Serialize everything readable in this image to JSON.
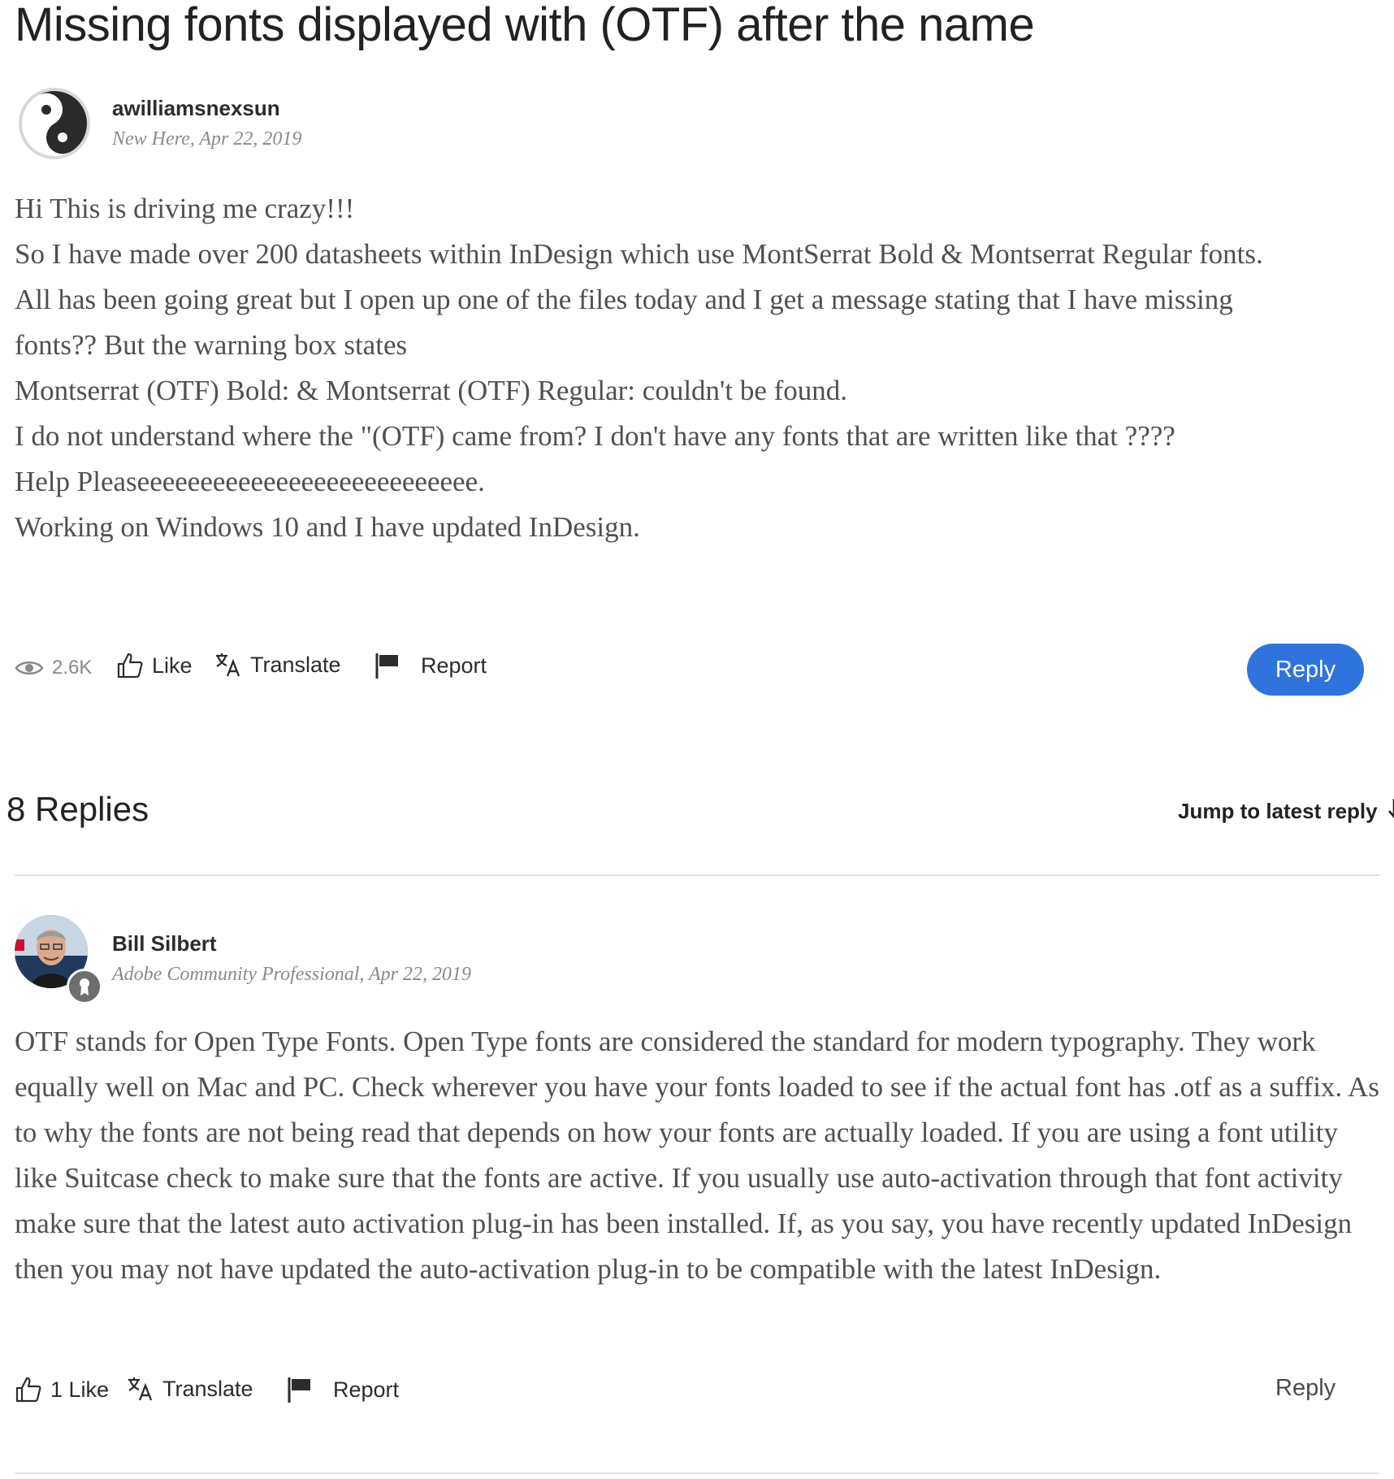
{
  "title": "Missing fonts displayed with (OTF) after the name",
  "post": {
    "author": "awilliamsnexsun",
    "rank": "New Here",
    "date": "Apr 22, 2019",
    "lines": [
      "Hi This is driving me crazy!!!",
      "So I have made over 200 datasheets within InDesign which use MontSerrat Bold & Montserrat Regular fonts.",
      "All has been going great but I open up one of the files today and I get a message stating that I have missing",
      "fonts?? But the warning box states",
      "Montserrat (OTF) Bold: & Montserrat (OTF) Regular: couldn't be found.",
      "I do not understand where the \"(OTF) came from? I don't have any fonts that are written like that ????",
      "Help Pleaseeeeeeeeeeeeeeeeeeeeeeeeeee.",
      "Working on Windows 10 and I have updated InDesign."
    ],
    "views": "2.6K",
    "like_label": "Like",
    "translate_label": "Translate",
    "report_label": "Report",
    "reply_label": "Reply"
  },
  "replies_heading": "8 Replies",
  "jump_label": "Jump to latest reply",
  "reply": {
    "author": "Bill Silbert",
    "rank": "Adobe Community Professional",
    "date": "Apr 22, 2019",
    "body": "OTF stands for Open Type Fonts. Open Type fonts are considered the standard for modern typography. They work equally well on Mac and PC. Check wherever you have your fonts loaded to see if the actual font has .otf as a suffix. As to why the fonts are not being read that depends on how your fonts are actually loaded. If you are using a font utility like Suitcase check to make sure that the fonts are active. If you usually use auto-activation through that font activity make sure that the latest auto activation plug-in has been installed. If, as you say, you have recently updated InDesign then you may not have updated the auto-activation plug-in to be compatible with the latest InDesign.",
    "like_label": "1 Like",
    "translate_label": "Translate",
    "report_label": "Report",
    "reply_label": "Reply"
  },
  "colors": {
    "accent": "#2f74dc",
    "text": "#505050",
    "meta": "#8a8a8a"
  },
  "icons": [
    "eye-icon",
    "thumbs-up-icon",
    "translate-icon",
    "flag-icon",
    "arrow-down-icon",
    "award-badge-icon"
  ]
}
